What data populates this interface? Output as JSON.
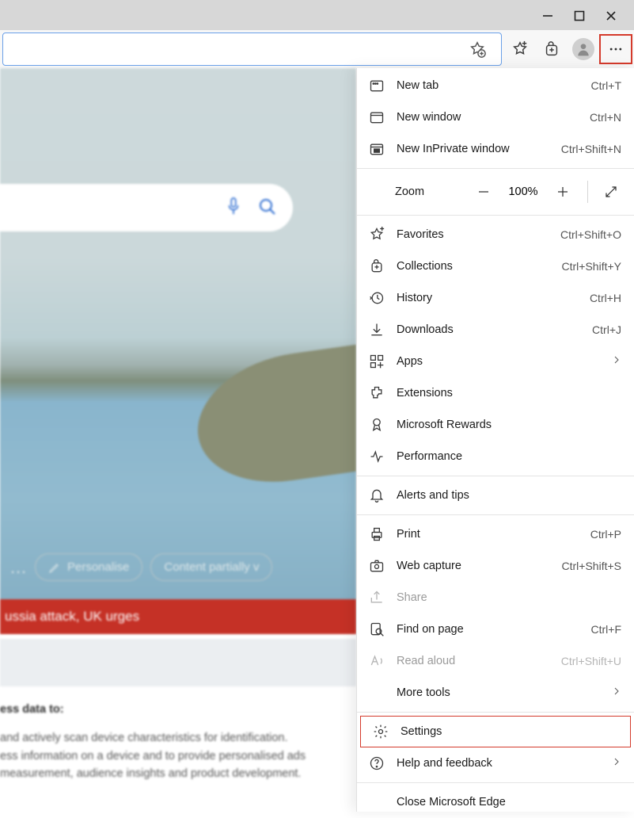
{
  "titlebar": {
    "minimize": "–",
    "maximize": "▢",
    "close": "✕"
  },
  "toolbar": {
    "bookmark_star_add": "star-add",
    "favorites": "favorites",
    "collections": "collections",
    "profile": "profile",
    "menu": "menu"
  },
  "content": {
    "personalise": "Personalise",
    "content_partial": "Content partially v",
    "banner": "ussia attack, UK urges",
    "dots": "…",
    "consent_header": "ess data to:",
    "consent_line1": "and actively scan device characteristics for identification.",
    "consent_line2": "ess information on a device and to provide personalised ads",
    "consent_line3": "measurement, audience insights and product development."
  },
  "menu": {
    "zoom_label": "Zoom",
    "zoom_value": "100%",
    "items": {
      "new_tab": {
        "label": "New tab",
        "shortcut": "Ctrl+T"
      },
      "new_window": {
        "label": "New window",
        "shortcut": "Ctrl+N"
      },
      "new_inprivate": {
        "label": "New InPrivate window",
        "shortcut": "Ctrl+Shift+N"
      },
      "favorites": {
        "label": "Favorites",
        "shortcut": "Ctrl+Shift+O"
      },
      "collections": {
        "label": "Collections",
        "shortcut": "Ctrl+Shift+Y"
      },
      "history": {
        "label": "History",
        "shortcut": "Ctrl+H"
      },
      "downloads": {
        "label": "Downloads",
        "shortcut": "Ctrl+J"
      },
      "apps": {
        "label": "Apps"
      },
      "extensions": {
        "label": "Extensions"
      },
      "rewards": {
        "label": "Microsoft Rewards"
      },
      "performance": {
        "label": "Performance"
      },
      "alerts": {
        "label": "Alerts and tips"
      },
      "print": {
        "label": "Print",
        "shortcut": "Ctrl+P"
      },
      "webcapture": {
        "label": "Web capture",
        "shortcut": "Ctrl+Shift+S"
      },
      "share": {
        "label": "Share"
      },
      "findonpage": {
        "label": "Find on page",
        "shortcut": "Ctrl+F"
      },
      "readaloud": {
        "label": "Read aloud",
        "shortcut": "Ctrl+Shift+U"
      },
      "moretools": {
        "label": "More tools"
      },
      "settings": {
        "label": "Settings"
      },
      "help": {
        "label": "Help and feedback"
      },
      "close_edge": {
        "label": "Close Microsoft Edge"
      }
    }
  }
}
